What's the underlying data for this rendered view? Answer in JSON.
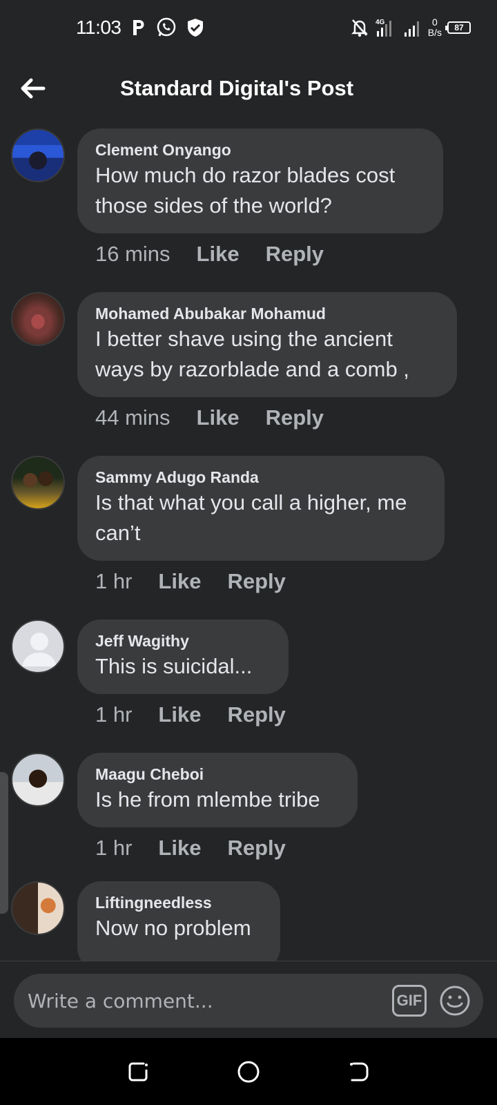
{
  "status_bar": {
    "time": "11:03",
    "network_badge": "4G",
    "speed_value": "0",
    "speed_unit": "B/s",
    "battery": "87",
    "icons": [
      "parking-icon",
      "whatsapp-icon",
      "shield-icon",
      "bell-off-icon",
      "signal-icon",
      "signal-icon",
      "battery-icon"
    ]
  },
  "header": {
    "title": "Standard Digital's Post",
    "back_icon": "arrow-left-icon"
  },
  "comments": [
    {
      "author": "Clement Onyango",
      "text": "How much do razor blades cost those sides of the world?",
      "time": "16 mins",
      "like": "Like",
      "reply": "Reply"
    },
    {
      "author": "Mohamed Abubakar Mohamud",
      "text": "I better shave using the ancient ways by  razorblade and a comb ,",
      "time": "44 mins",
      "like": "Like",
      "reply": "Reply"
    },
    {
      "author": "Sammy Adugo Randa",
      "text": "Is that what you call a higher, me can’t",
      "time": "1 hr",
      "like": "Like",
      "reply": "Reply"
    },
    {
      "author": "Jeff Wagithy",
      "text": "This is suicidal...",
      "time": "1 hr",
      "like": "Like",
      "reply": "Reply"
    },
    {
      "author": "Maagu Cheboi",
      "text": "Is he from mlembe tribe",
      "time": "1 hr",
      "like": "Like",
      "reply": "Reply"
    },
    {
      "author": "Liftingneedless",
      "text": "Now no problem"
    }
  ],
  "composer": {
    "placeholder": "Write a comment...",
    "gif_label": "GIF",
    "emoji_icon": "smiley-icon"
  },
  "nav_bar": {
    "icons": [
      "recent-apps-icon",
      "home-icon",
      "back-icon"
    ]
  },
  "colors": {
    "background": "#242526",
    "bubble": "#3a3b3c",
    "text_primary": "#e4e6eb",
    "text_secondary": "#b0b3b8"
  }
}
